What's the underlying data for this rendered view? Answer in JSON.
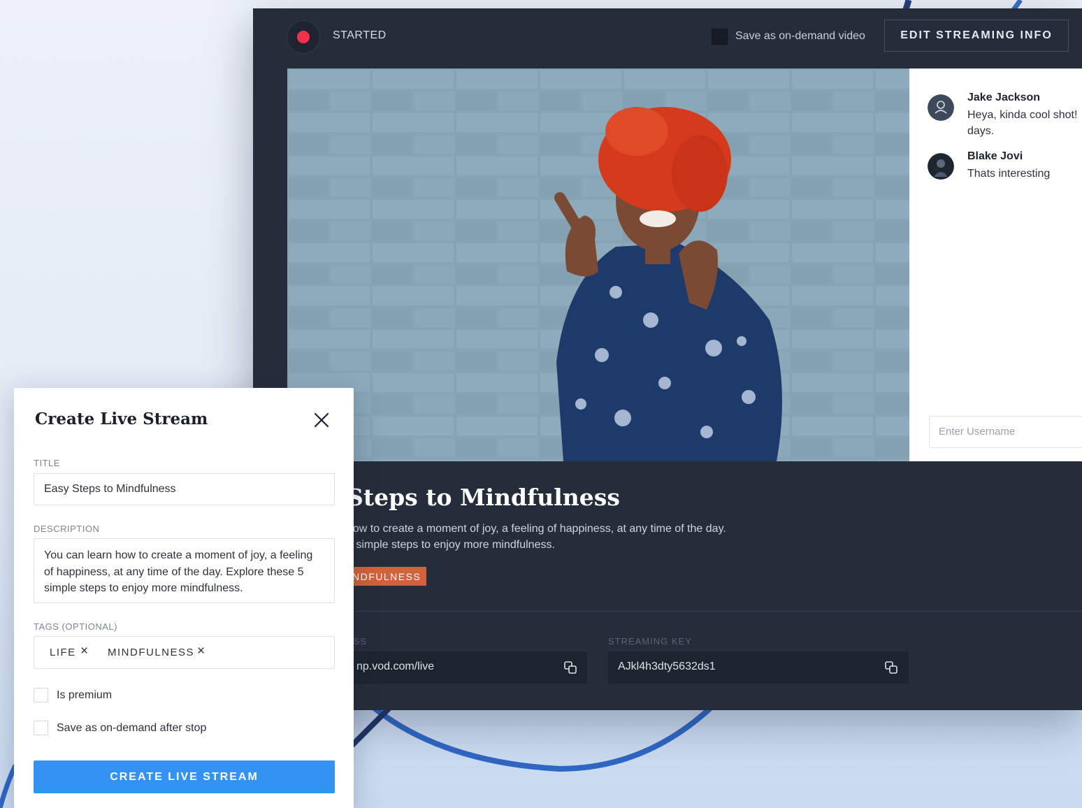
{
  "stream": {
    "status": "STARTED",
    "save_on_demand_label": "Save as on-demand video",
    "edit_button": "EDIT STREAMING INFO",
    "title": "Steps to Mindfulness",
    "description_line1": "how to create a moment of joy, a feeling of happiness, at any time of the day.",
    "description_line2": "5 simple steps to enjoy more mindfulness.",
    "tag": "NDFULNESS",
    "address_label": "ESS",
    "address_value": "np.vod.com/live",
    "streaming_key_label": "STREAMING KEY",
    "streaming_key_value": "AJkl4h3dty5632ds1"
  },
  "chat": {
    "messages": [
      {
        "name": "Jake Jackson",
        "text": "Heya, kinda cool shot! days."
      },
      {
        "name": "Blake Jovi",
        "text": "Thats interesting"
      }
    ],
    "input_placeholder": "Enter Username"
  },
  "modal": {
    "title": "Create Live Stream",
    "title_label": "TITLE",
    "title_value": "Easy Steps to Mindfulness",
    "description_label": "DESCRIPTION",
    "description_value": "You can learn how to create a moment of joy, a feeling of happiness, at any time of the day. Explore these 5 simple steps to enjoy more mindfulness.",
    "tags_label": "TAGS (OPTIONAL)",
    "tags": [
      "LIFE",
      "MINDFULNESS"
    ],
    "is_premium_label": "Is premium",
    "save_after_stop_label": "Save as on-demand after stop",
    "create_button": "CREATE LIVE STREAM"
  },
  "colors": {
    "accent_blue": "#3393f2",
    "record_red": "#f0314a",
    "tag_orange": "#d0633b",
    "panel_dark": "#262d3a"
  },
  "icons": [
    "record-icon",
    "copy-icon",
    "close-icon",
    "user-icon"
  ]
}
